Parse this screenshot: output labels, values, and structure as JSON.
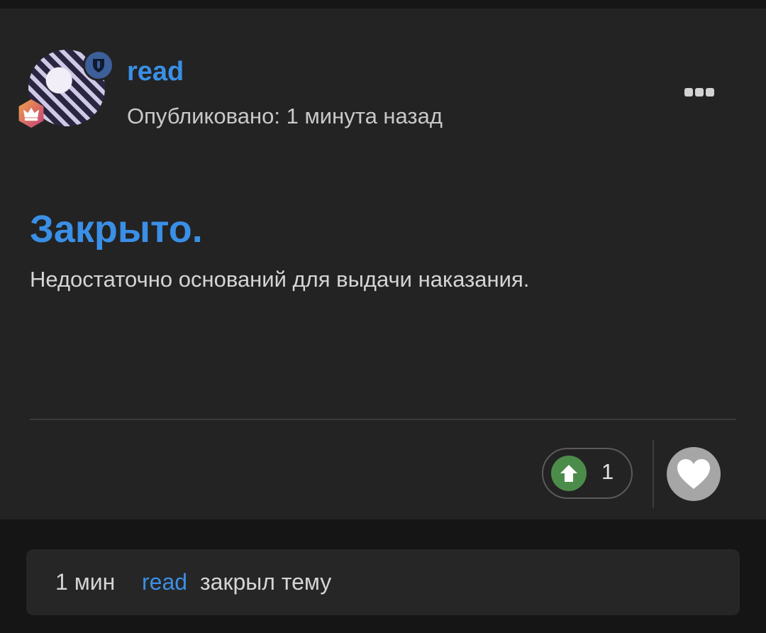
{
  "post": {
    "username": "read",
    "published": "Опубликовано: 1 минута назад",
    "title": "Закрыто.",
    "body": "Недостаточно оснований для выдачи наказания.",
    "upvote_count": "1"
  },
  "event": {
    "time": "1 мин",
    "user": "read",
    "action": "закрыл тему"
  },
  "icons": {
    "shield": "shield-icon",
    "crown": "crown-icon",
    "more": "more-horizontal-icon",
    "upvote": "arrow-up-icon",
    "like": "heart-icon"
  },
  "colors": {
    "accent": "#3a8fe6",
    "upvote": "#4c8c4a",
    "like": "#a6a6a6",
    "background": "#232323"
  }
}
